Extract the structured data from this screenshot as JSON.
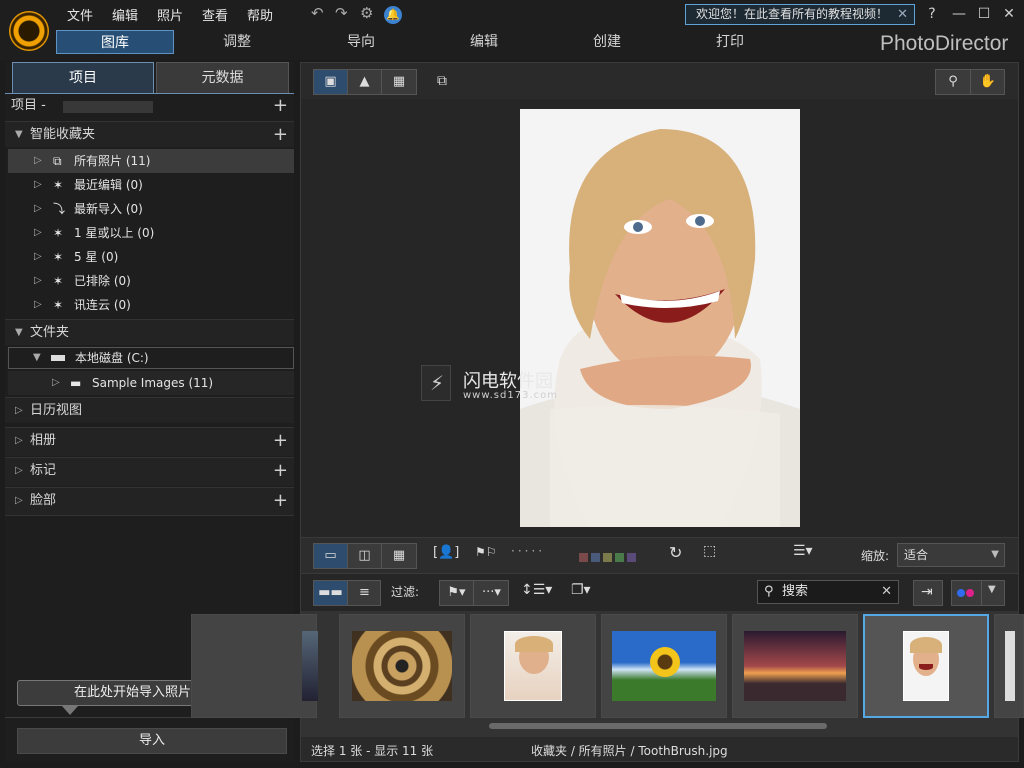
{
  "menu": [
    "文件",
    "编辑",
    "照片",
    "查看",
    "帮助"
  ],
  "welcome": "欢迎您！在此查看所有的教程视频！",
  "brand": "PhotoDirector",
  "modes": [
    "图库",
    "调整",
    "导向",
    "编辑",
    "创建",
    "打印"
  ],
  "left": {
    "tabs": [
      "项目",
      "元数据"
    ],
    "project_label": "项目 -",
    "smart_collections": {
      "title": "智能收藏夹",
      "items": [
        "所有照片 (11)",
        "最近编辑 (0)",
        "最新导入 (0)",
        "1 星或以上 (0)",
        "5 星 (0)",
        "已排除 (0)",
        "讯连云 (0)"
      ]
    },
    "folders": {
      "title": "文件夹",
      "drive": "本地磁盘 (C:)",
      "sub": "Sample Images (11)"
    },
    "calendar": "日历视图",
    "album": "相册",
    "tags": "标记",
    "faces": "脸部",
    "tip": "在此处开始导入照片和视频",
    "import": "导入"
  },
  "viewer": {
    "zoom_label": "缩放:",
    "zoom_value": "适合",
    "filter_label": "过滤:",
    "search_placeholder": "搜索",
    "watermark_brand": "闪电软件园",
    "watermark_url": "www.sd173.com"
  },
  "status": {
    "left": "选择 1 张 - 显示 11 张",
    "path": "收藏夹 / 所有照片 / ToothBrush.jpg"
  }
}
